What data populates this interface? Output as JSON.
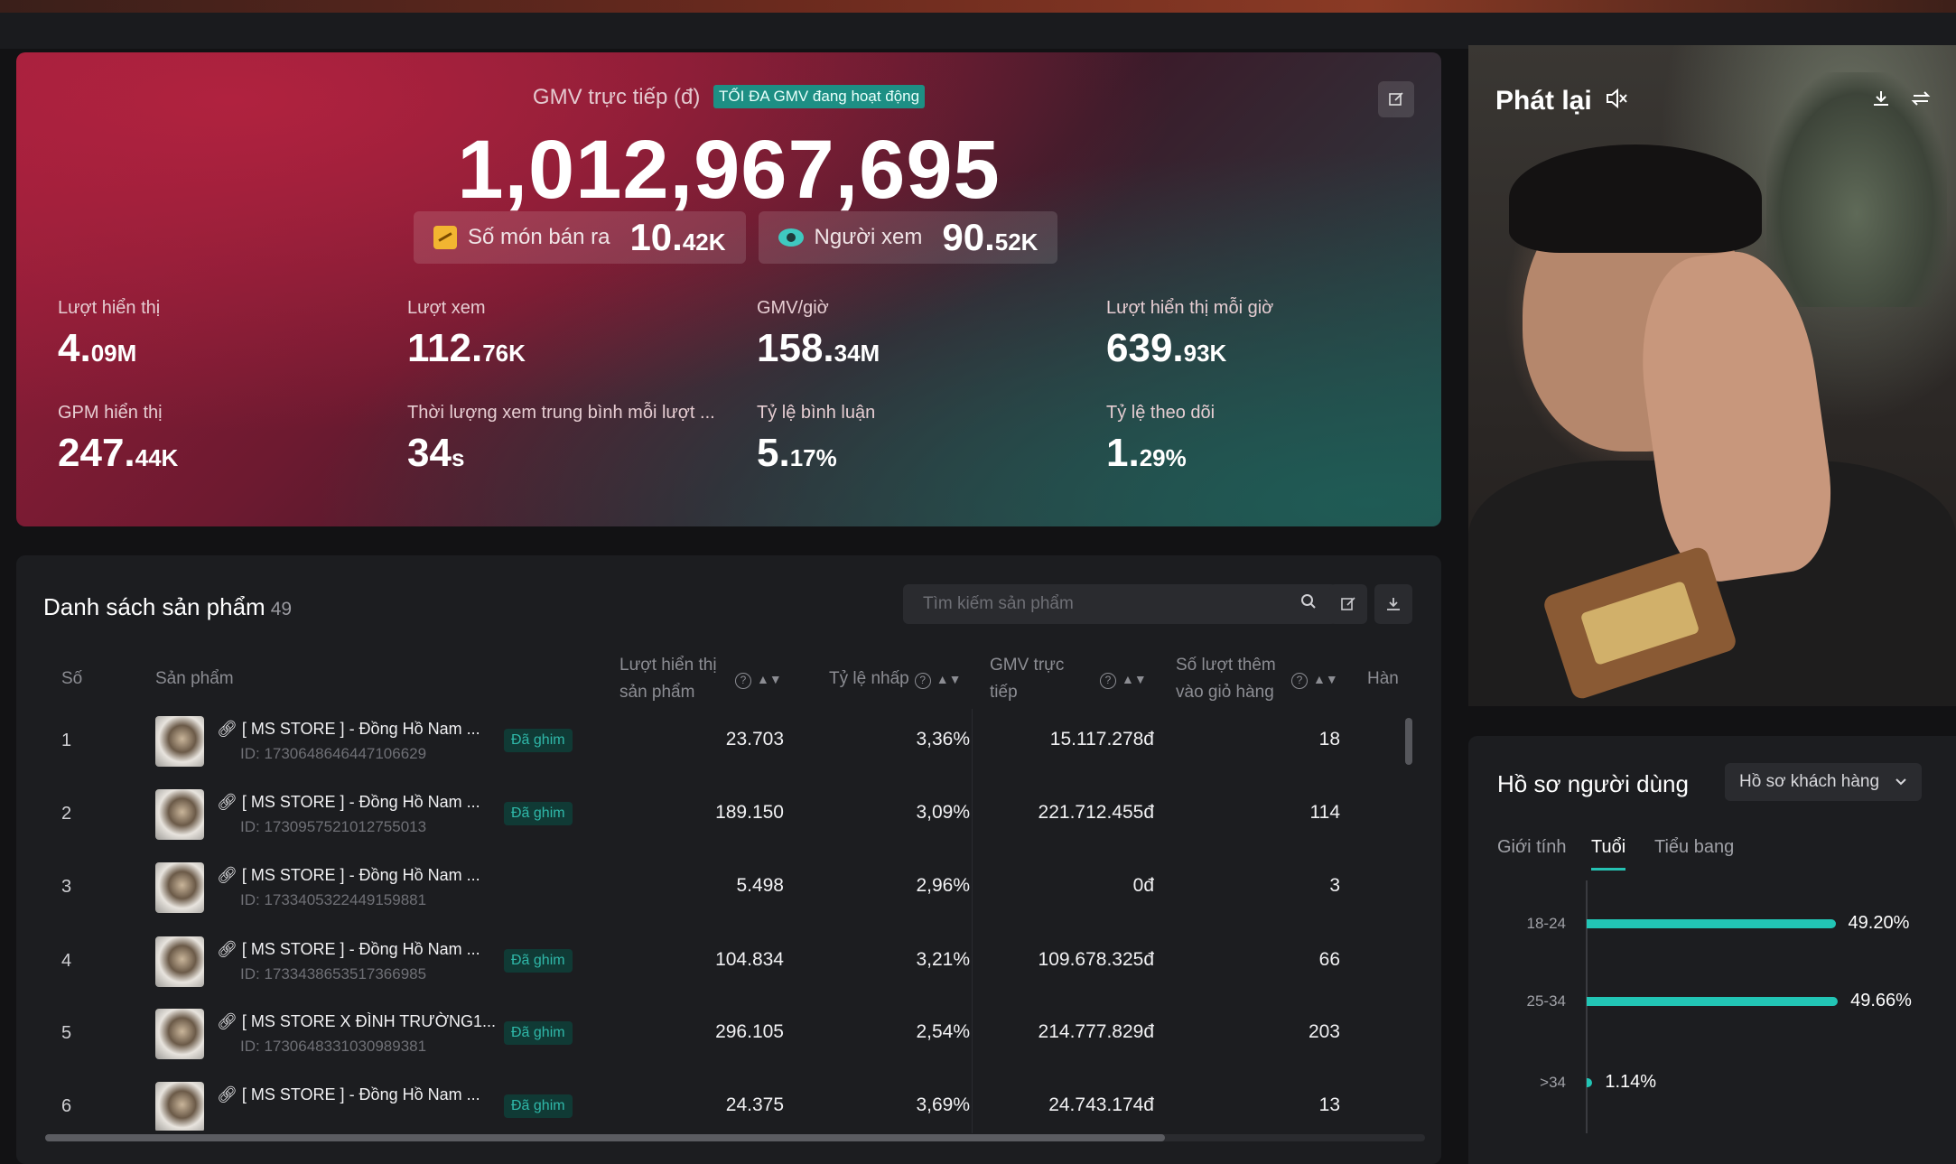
{
  "hero": {
    "title": "GMV trực tiếp (đ)",
    "tag": "TỐI ĐA GMV đang hoạt động",
    "gmv": "1,012,967,695",
    "items_sold_label": "Số món bán ra",
    "items_sold_value": "10.",
    "items_sold_unit": "42K",
    "viewers_label": "Người xem",
    "viewers_value": "90.",
    "viewers_unit": "52K",
    "metrics": [
      {
        "label": "Lượt hiển thị",
        "value": "4.",
        "unit": "09M"
      },
      {
        "label": "Lượt xem",
        "value": "112.",
        "unit": "76K"
      },
      {
        "label": "GMV/giờ",
        "value": "158.",
        "unit": "34M"
      },
      {
        "label": "Lượt hiển thị mỗi giờ",
        "value": "639.",
        "unit": "93K"
      },
      {
        "label": "GPM hiển thị",
        "value": "247.",
        "unit": "44K"
      },
      {
        "label": "Thời lượng xem trung bình mỗi lượt ...",
        "value": "34",
        "unit": "s"
      },
      {
        "label": "Tỷ lệ bình luận",
        "value": "5.",
        "unit": "17%"
      },
      {
        "label": "Tỷ lệ theo dõi",
        "value": "1.",
        "unit": "29%"
      }
    ]
  },
  "video": {
    "title": "Phát lại",
    "icons": [
      "mute-icon",
      "download-icon",
      "switch-icon"
    ]
  },
  "products": {
    "title": "Danh sách sản phẩm",
    "count": "49",
    "search_placeholder": "Tìm kiếm sản phẩm",
    "columns": {
      "no": "Số",
      "product": "Sản phẩm",
      "impressions": [
        "Lượt hiển thị",
        "sản phẩm"
      ],
      "ctr": "Tỷ lệ nhấp",
      "gmv": [
        "GMV trực",
        "tiếp"
      ],
      "add_to_cart": [
        "Số lượt thêm",
        "vào giỏ hàng"
      ],
      "next": "Hàn"
    },
    "pinned_label": "Đã ghim",
    "rows": [
      {
        "no": "1",
        "name": "[ MS STORE ] - Đồng Hồ Nam ...",
        "id": "ID: 1730648646447106629",
        "pinned": true,
        "impressions": "23.703",
        "ctr": "3,36%",
        "gmv": "15.117.278đ",
        "atc": "18"
      },
      {
        "no": "2",
        "name": "[ MS STORE ] - Đồng Hồ Nam ...",
        "id": "ID: 1730957521012755013",
        "pinned": true,
        "impressions": "189.150",
        "ctr": "3,09%",
        "gmv": "221.712.455đ",
        "atc": "114"
      },
      {
        "no": "3",
        "name": "[ MS STORE ] - Đồng Hồ Nam ...",
        "id": "ID: 1733405322449159881",
        "pinned": false,
        "impressions": "5.498",
        "ctr": "2,96%",
        "gmv": "0đ",
        "atc": "3"
      },
      {
        "no": "4",
        "name": "[ MS STORE ] - Đồng Hồ Nam ...",
        "id": "ID: 1733438653517366985",
        "pinned": true,
        "impressions": "104.834",
        "ctr": "3,21%",
        "gmv": "109.678.325đ",
        "atc": "66"
      },
      {
        "no": "5",
        "name": "[ MS STORE X ĐÌNH TRƯỜNG1...",
        "id": "ID: 1730648331030989381",
        "pinned": true,
        "impressions": "296.105",
        "ctr": "2,54%",
        "gmv": "214.777.829đ",
        "atc": "203"
      },
      {
        "no": "6",
        "name": "[ MS STORE ] - Đồng Hồ Nam ...",
        "id": "",
        "pinned": true,
        "impressions": "24.375",
        "ctr": "3,69%",
        "gmv": "24.743.174đ",
        "atc": "13"
      }
    ]
  },
  "profile": {
    "title": "Hồ sơ người dùng",
    "dropdown": "Hồ sơ khách hàng",
    "tabs": [
      "Giới tính",
      "Tuổi",
      "Tiểu bang"
    ],
    "active_tab": "Tuổi",
    "age_bars": [
      {
        "label": "18-24",
        "value": 49.2,
        "text": "49.20%"
      },
      {
        "label": "25-34",
        "value": 49.66,
        "text": "49.66%"
      },
      {
        "label": ">34",
        "value": 1.14,
        "text": "1.14%"
      }
    ]
  },
  "colors": {
    "accent_teal": "#22c5b5",
    "pinned_bg": "#103a35",
    "hero_red": "#9b1e3a"
  }
}
